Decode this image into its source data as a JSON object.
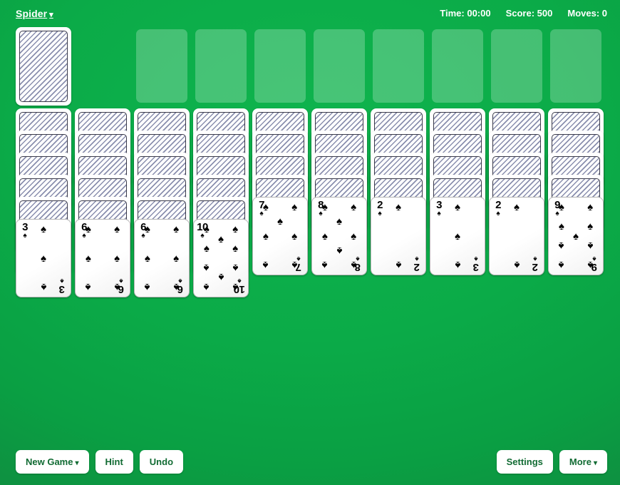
{
  "header": {
    "title": "Spider",
    "title_caret": "▾",
    "status": {
      "time": "Time: 00:00",
      "score": "Score: 500",
      "moves": "Moves: 0"
    }
  },
  "board": {
    "stock_label": "stock-pile",
    "foundation_count": 8,
    "suit_glyph": "♠",
    "columns": [
      {
        "facedown": 5,
        "faceup": [
          {
            "rank": "3",
            "suit": "♠",
            "pips": 3
          }
        ]
      },
      {
        "facedown": 5,
        "faceup": [
          {
            "rank": "6",
            "suit": "♠",
            "pips": 6
          }
        ]
      },
      {
        "facedown": 5,
        "faceup": [
          {
            "rank": "6",
            "suit": "♠",
            "pips": 6
          }
        ]
      },
      {
        "facedown": 5,
        "faceup": [
          {
            "rank": "10",
            "suit": "♠",
            "pips": 10
          }
        ]
      },
      {
        "facedown": 4,
        "faceup": [
          {
            "rank": "7",
            "suit": "♠",
            "pips": 7
          }
        ]
      },
      {
        "facedown": 4,
        "faceup": [
          {
            "rank": "8",
            "suit": "♠",
            "pips": 8
          }
        ]
      },
      {
        "facedown": 4,
        "faceup": [
          {
            "rank": "2",
            "suit": "♠",
            "pips": 2
          }
        ]
      },
      {
        "facedown": 4,
        "faceup": [
          {
            "rank": "3",
            "suit": "♠",
            "pips": 3
          }
        ]
      },
      {
        "facedown": 4,
        "faceup": [
          {
            "rank": "2",
            "suit": "♠",
            "pips": 2
          }
        ]
      },
      {
        "facedown": 4,
        "faceup": [
          {
            "rank": "9",
            "suit": "♠",
            "pips": 9
          }
        ]
      }
    ]
  },
  "toolbar": {
    "left": [
      {
        "label": "New Game",
        "caret": "▾",
        "name": "new-game-button"
      },
      {
        "label": "Hint",
        "caret": "",
        "name": "hint-button"
      },
      {
        "label": "Undo",
        "caret": "",
        "name": "undo-button"
      }
    ],
    "right": [
      {
        "label": "Settings",
        "caret": "",
        "name": "settings-button"
      },
      {
        "label": "More",
        "caret": "▾",
        "name": "more-button"
      }
    ]
  },
  "colors": {
    "felt_center": "#0fb44e",
    "felt_edge": "#137c3c",
    "card_face": "#ffffff",
    "suit_black": "#000000",
    "button_text": "#116b33"
  }
}
